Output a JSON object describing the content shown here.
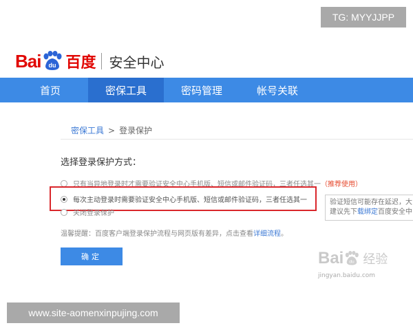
{
  "watermark_top": "TG: MYYJJPP",
  "watermark_bottom": "www.site-aomenxinpujing.com",
  "logo": {
    "latin": "Bai",
    "paw_text": "du",
    "chinese": "百度",
    "title": "安全中心"
  },
  "nav": {
    "tabs": [
      {
        "label": "首页",
        "active": false
      },
      {
        "label": "密保工具",
        "active": true
      },
      {
        "label": "密码管理",
        "active": false
      },
      {
        "label": "帐号关联",
        "active": false
      }
    ]
  },
  "breadcrumb": {
    "parent": "密保工具",
    "separator": ">",
    "current": "登录保护"
  },
  "section_title": "选择登录保护方式：",
  "options": [
    {
      "text": "只有当异地登录时才需要验证安全中心手机版、短信或邮件验证码，三者任选其一",
      "note": "（推荐使用）",
      "checked": false
    },
    {
      "text": "每次主动登录时需要验证安全中心手机版、短信或邮件验证码，三者任选其一",
      "checked": true
    },
    {
      "text": "关闭登录保护",
      "checked": false
    }
  ],
  "tip": {
    "line1": "验证短信可能存在延迟，大",
    "line2_prefix": "建议先下",
    "line2_link": "载绑定",
    "line2_suffix": "百度安全中"
  },
  "reminder": {
    "text": "温馨提醒：百度客户端登录保护流程与网页版有差异，点击查看",
    "link": "详细流程",
    "end": "。"
  },
  "confirm_label": "确定",
  "bottom_watermark_logo": {
    "latin": "Bai",
    "paw_text": "du",
    "chinese": "经验",
    "url": "jingyan.baidu.com"
  },
  "colors": {
    "brand_red": "#e10602",
    "nav_blue": "#3d8ae5",
    "nav_active": "#2a6fcf",
    "highlight_red": "#d9262b",
    "link_blue": "#3d7ad5"
  }
}
